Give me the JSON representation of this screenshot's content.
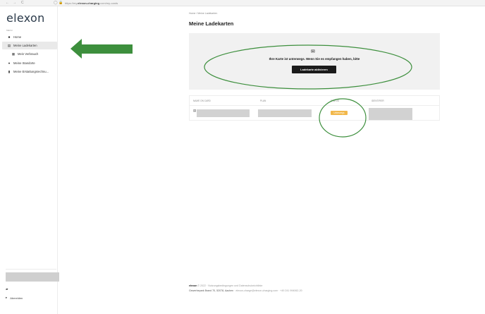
{
  "browser": {
    "back": "←",
    "forward": "→",
    "reload": "C",
    "site_icons": "◯ 🔒",
    "url_prefix": "https://my.",
    "url_domain": "elexon-charging",
    "url_suffix": ".com/my-cards"
  },
  "sidebar": {
    "logo": "elexon",
    "menu_caption": "MENU",
    "items": [
      {
        "label": "Home",
        "icon": "home-icon",
        "glyph": "■"
      },
      {
        "label": "Meine Ladekarten",
        "icon": "card-icon",
        "glyph": "▤"
      },
      {
        "label": "Mein Verbrauch",
        "icon": "chart-icon",
        "glyph": "▦"
      },
      {
        "label": "Meine Standorte",
        "icon": "pin-icon",
        "glyph": "●"
      },
      {
        "label": "Meine Erstattungsrechnu...",
        "icon": "document-icon",
        "glyph": "▮"
      }
    ],
    "bottom_item": {
      "glyph": "▰",
      "label": ""
    },
    "logout": {
      "label": "Abmelden",
      "glyph": "▸"
    }
  },
  "main": {
    "breadcrumb": "Home  /  Meine Ladekarten",
    "title": "Meine Ladekarten",
    "notice": {
      "mail_glyph": "✉",
      "message": "Ihre Karte ist unterwegs. Wenn Sie es empfangen haben, bitte",
      "button_label": "Ladekarte aktivieren"
    },
    "table": {
      "columns": [
        "NAME ON CARD",
        "PLAN",
        "STATUS",
        "IDENTIFIER"
      ],
      "row_icon": "▤",
      "status_value": "Unterwegs"
    }
  },
  "footer": {
    "brand": "elexon",
    "line1": "© 2022 · Nutzungsbedingungen und Datenschutzrichtlinie",
    "address": "Gewerbepark Brand 70, 52078, Aachen",
    "contact": " · elexon-charge@elexon-charging.com · +49 241 994062-20"
  },
  "colors": {
    "annotation_green": "#3d8f3d",
    "status_badge": "#f2b84b",
    "button": "#1b1b1b",
    "card_bg": "#f1f1f1"
  }
}
